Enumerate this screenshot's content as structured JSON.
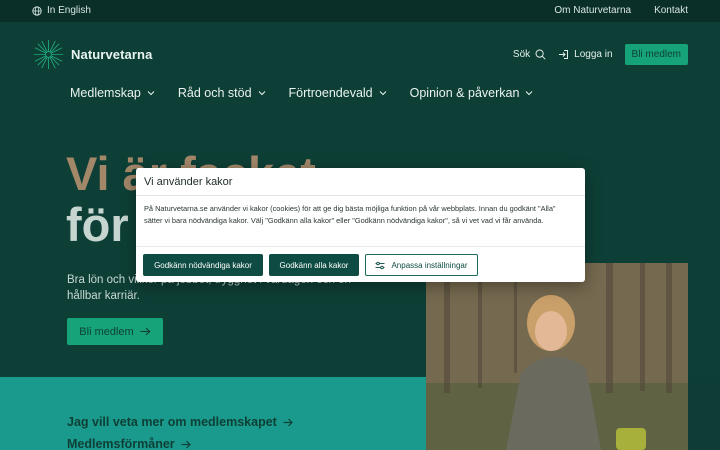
{
  "topbar": {
    "language": "In English",
    "links": [
      "Om Naturvetarna",
      "Kontakt"
    ]
  },
  "header": {
    "logo_text": "Naturvetarna",
    "search_label": "Sök",
    "login_label": "Logga in",
    "member_button": "Bli medlem"
  },
  "nav": {
    "items": [
      "Medlemskap",
      "Råd och stöd",
      "Förtroendevald",
      "Opinion & påverkan"
    ]
  },
  "hero": {
    "title_line1": "Vi är facket",
    "title_line2": "för",
    "subtitle": "Bra lön och villkor på jobbet, trygghet i vardagen och en hållbar karriär.",
    "cta": "Bli medlem"
  },
  "links": {
    "membership_info": "Jag vill veta mer om medlemskapet",
    "benefits": "Medlemsförmåner"
  },
  "cookie_dialog": {
    "title": "Vi använder kakor",
    "body": "På Naturvetarna.se använder vi kakor (cookies) för att ge dig bästa möjliga funktion på vår webbplats. Innan du godkänt \"Alla\" sätter vi bara nödvändiga kakor. Välj \"Godkänn alla kakor\" eller \"Godkänn nödvändiga kakor\", så vi vet vad vi får använda.",
    "btn_necessary": "Godkänn nödvändiga kakor",
    "btn_all": "Godkänn alla kakor",
    "btn_customize": "Anpassa inställningar"
  },
  "colors": {
    "header_bg": "#0e3f36",
    "accent": "#17a37a",
    "teal_band": "#1a9a8c",
    "title_brown": "#a38769"
  }
}
